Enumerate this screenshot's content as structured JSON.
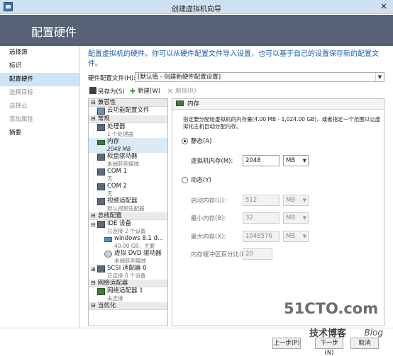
{
  "window": {
    "title": "创建虚拟机向导",
    "close_glyph": "✕"
  },
  "header": {
    "title": "配置硬件"
  },
  "nav": {
    "items": [
      {
        "label": "选择源",
        "state": "normal"
      },
      {
        "label": "标识",
        "state": "normal"
      },
      {
        "label": "配置硬件",
        "state": "active"
      },
      {
        "label": "选择目标",
        "state": "disabled"
      },
      {
        "label": "选择云",
        "state": "disabled"
      },
      {
        "label": "添加属性",
        "state": "disabled"
      },
      {
        "label": "摘要",
        "state": "normal"
      }
    ]
  },
  "main": {
    "intro": "配置虚拟机的硬件。你可以从硬件配置文件导入设置，也可以基于自己的设置保存新的配置文件。",
    "profile_label": "硬件配置文件(H):",
    "profile_value": "[默认值 - 创建新硬件配置设置]"
  },
  "toolbar": {
    "save_as": "另存为(S)",
    "new": "新建(W)",
    "delete": "删除(R)"
  },
  "tree": {
    "cat_compat": "兼容性",
    "compat_item": "云功能配置文件",
    "cat_general": "常规",
    "processor": {
      "label": "处理器",
      "sub": "1 个处理器"
    },
    "memory": {
      "label": "内存",
      "sub": "2048 MB"
    },
    "floppy": {
      "label": "软盘驱动器",
      "sub": "未捕获到媒体"
    },
    "com1": {
      "label": "COM 1",
      "sub": "无"
    },
    "com2": {
      "label": "COM 2",
      "sub": "无"
    },
    "video": {
      "label": "视频适配器",
      "sub": "默认视频适配器"
    },
    "cat_bus": "总线配置",
    "ide": {
      "label": "IDE 设备",
      "sub": "已连接 2 个设备"
    },
    "vhd": {
      "label": "windows 8.1 d...",
      "sub": "40.00 GB，主要"
    },
    "dvd": {
      "label": "虚拟 DVD 驱动器",
      "sub": "未捕获到媒体"
    },
    "scsi": {
      "label": "SCSI 适配器 0",
      "sub": "已连接 0 个设备"
    },
    "cat_net": "网络适配器",
    "nic": {
      "label": "网络适配器 1",
      "sub": "未连接"
    },
    "cat_more": "当优化"
  },
  "panel": {
    "title": "内存",
    "description": "指定要分配给虚拟机的内存量(4.00 MB - 1,024.00 GB)，或者指定一个范围以让虚拟化主机自动分配内存。",
    "static_label": "静态(A)",
    "vm_memory_label": "虚拟机内存(M):",
    "vm_memory_value": "2048",
    "vm_memory_unit": "MB",
    "dynamic_label": "动态(Y)",
    "startup_label": "启动内存(U):",
    "startup_value": "512",
    "startup_unit": "MB",
    "min_label": "最小内存(B):",
    "min_value": "32",
    "min_unit": "MB",
    "max_label": "最大内存(X):",
    "max_value": "1048576",
    "max_unit": "MB",
    "buffer_label": "内存缓冲区百分比(E):",
    "buffer_value": "20"
  },
  "footer": {
    "back": "上一步(P)",
    "next": "下一步(N)",
    "cancel": "取消"
  },
  "watermark": {
    "big": "51CTO.com",
    "small": "技术博客",
    "blog": "Blog"
  }
}
